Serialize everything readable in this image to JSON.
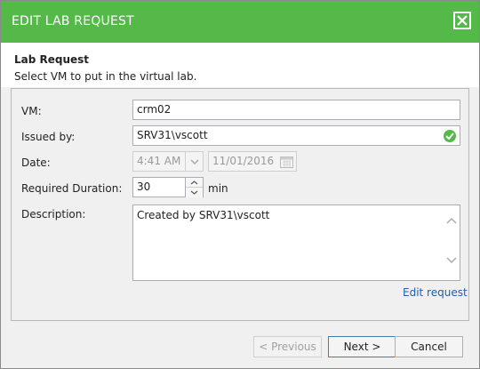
{
  "dialog": {
    "title": "EDIT LAB REQUEST",
    "section_title": "Lab Request",
    "section_subtitle": "Select VM to put in the virtual lab."
  },
  "form": {
    "vm_label": "VM:",
    "vm_value": "crm02",
    "issued_label": "Issued by:",
    "issued_value": "SRV31\\vscott",
    "date_label": "Date:",
    "time_value": "4:41 AM",
    "date_value": "11/01/2016",
    "duration_label": "Required Duration:",
    "duration_value": "30",
    "duration_unit": "min",
    "description_label": "Description:",
    "description_value": "Created by SRV31\\vscott",
    "edit_link": "Edit request"
  },
  "buttons": {
    "previous": "< Previous",
    "next": "Next >",
    "cancel": "Cancel"
  },
  "colors": {
    "titlebar": "#54b948",
    "link": "#1e5fa8"
  }
}
